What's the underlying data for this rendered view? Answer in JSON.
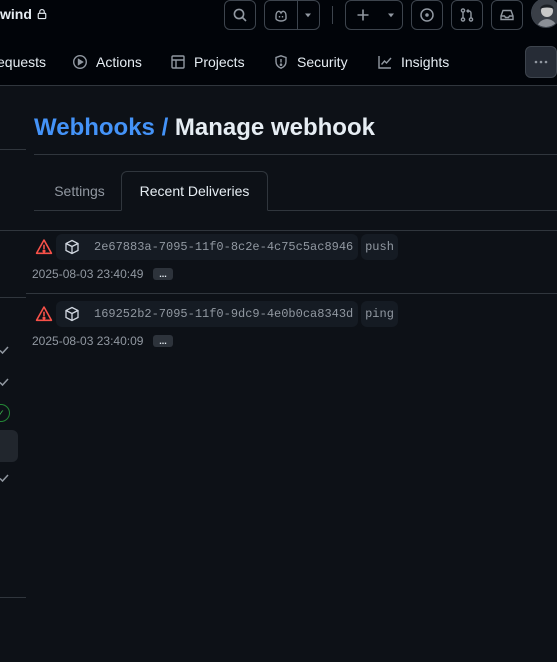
{
  "header": {
    "repo_name_partial": "wind",
    "lock_icon": "lock-icon",
    "buttons": [
      "search-icon",
      "copilot-icon",
      "triangle-down-icon",
      "plus-icon",
      "issue-opened-icon",
      "git-pull-request-icon",
      "inbox-icon"
    ]
  },
  "repo_nav": {
    "items": [
      {
        "label": "equests",
        "icon": "git-pull-request-icon"
      },
      {
        "label": "Actions",
        "icon": "play-icon"
      },
      {
        "label": "Projects",
        "icon": "table-icon"
      },
      {
        "label": "Security",
        "icon": "shield-icon"
      },
      {
        "label": "Insights",
        "icon": "graph-icon"
      }
    ],
    "more_icon": "kebab-horizontal-icon"
  },
  "page": {
    "breadcrumb": "Webhooks",
    "separator": " / ",
    "title": "Manage webhook"
  },
  "tabs": [
    {
      "label": "Settings",
      "selected": false
    },
    {
      "label": "Recent Deliveries",
      "selected": true
    }
  ],
  "deliveries": [
    {
      "guid": "2e67883a-7095-11f0-8c2e-4c75c5ac8946",
      "event": "push",
      "timestamp": "2025-08-03 23:40:49",
      "status_icon": "alert-icon"
    },
    {
      "guid": "169252b2-7095-11f0-9dc9-4e0b0ca8343d",
      "event": "ping",
      "timestamp": "2025-08-03 23:40:09",
      "status_icon": "alert-icon"
    }
  ],
  "ellipsis_label": "...",
  "colors": {
    "background": "#0d1117",
    "header_bg": "#010409",
    "border": "#30363d",
    "link": "#4493f8",
    "danger": "#f85149",
    "muted": "#9198a1"
  }
}
